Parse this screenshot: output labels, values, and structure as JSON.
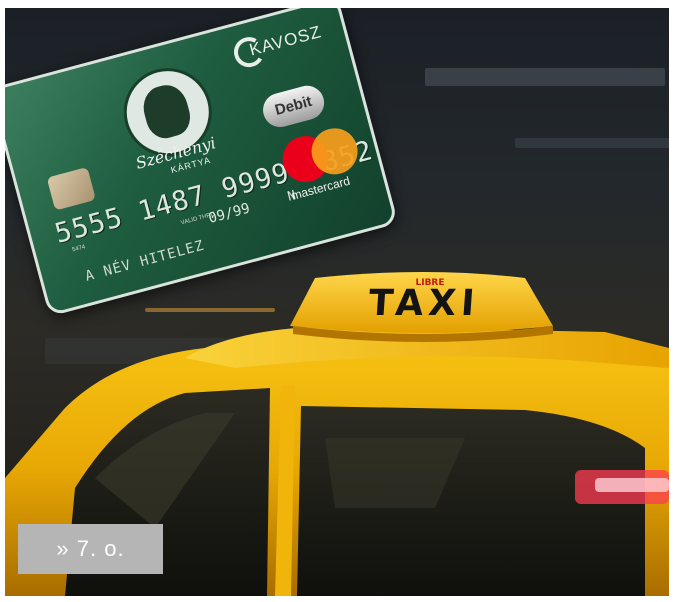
{
  "sign": {
    "text": "TAXI",
    "small_text": "LIBRE"
  },
  "card": {
    "brand": "KAVOSZ",
    "script": "Széchenyi",
    "kartya": "KÁRTYA",
    "number": "5555 1487 9999 9852",
    "small_code": "5474",
    "valid_thru": "VALID THRU",
    "expiry": "09/99",
    "expiry_suffix": "N",
    "holder": "A NÉV HITELEZ",
    "debit_label": "Debit",
    "network": "mastercard"
  },
  "badge": {
    "text": "» 7. o."
  },
  "colors": {
    "taxi_yellow": "#f2b705",
    "card_green": "#1f5e40",
    "badge_grey": "#b5b5b5"
  }
}
